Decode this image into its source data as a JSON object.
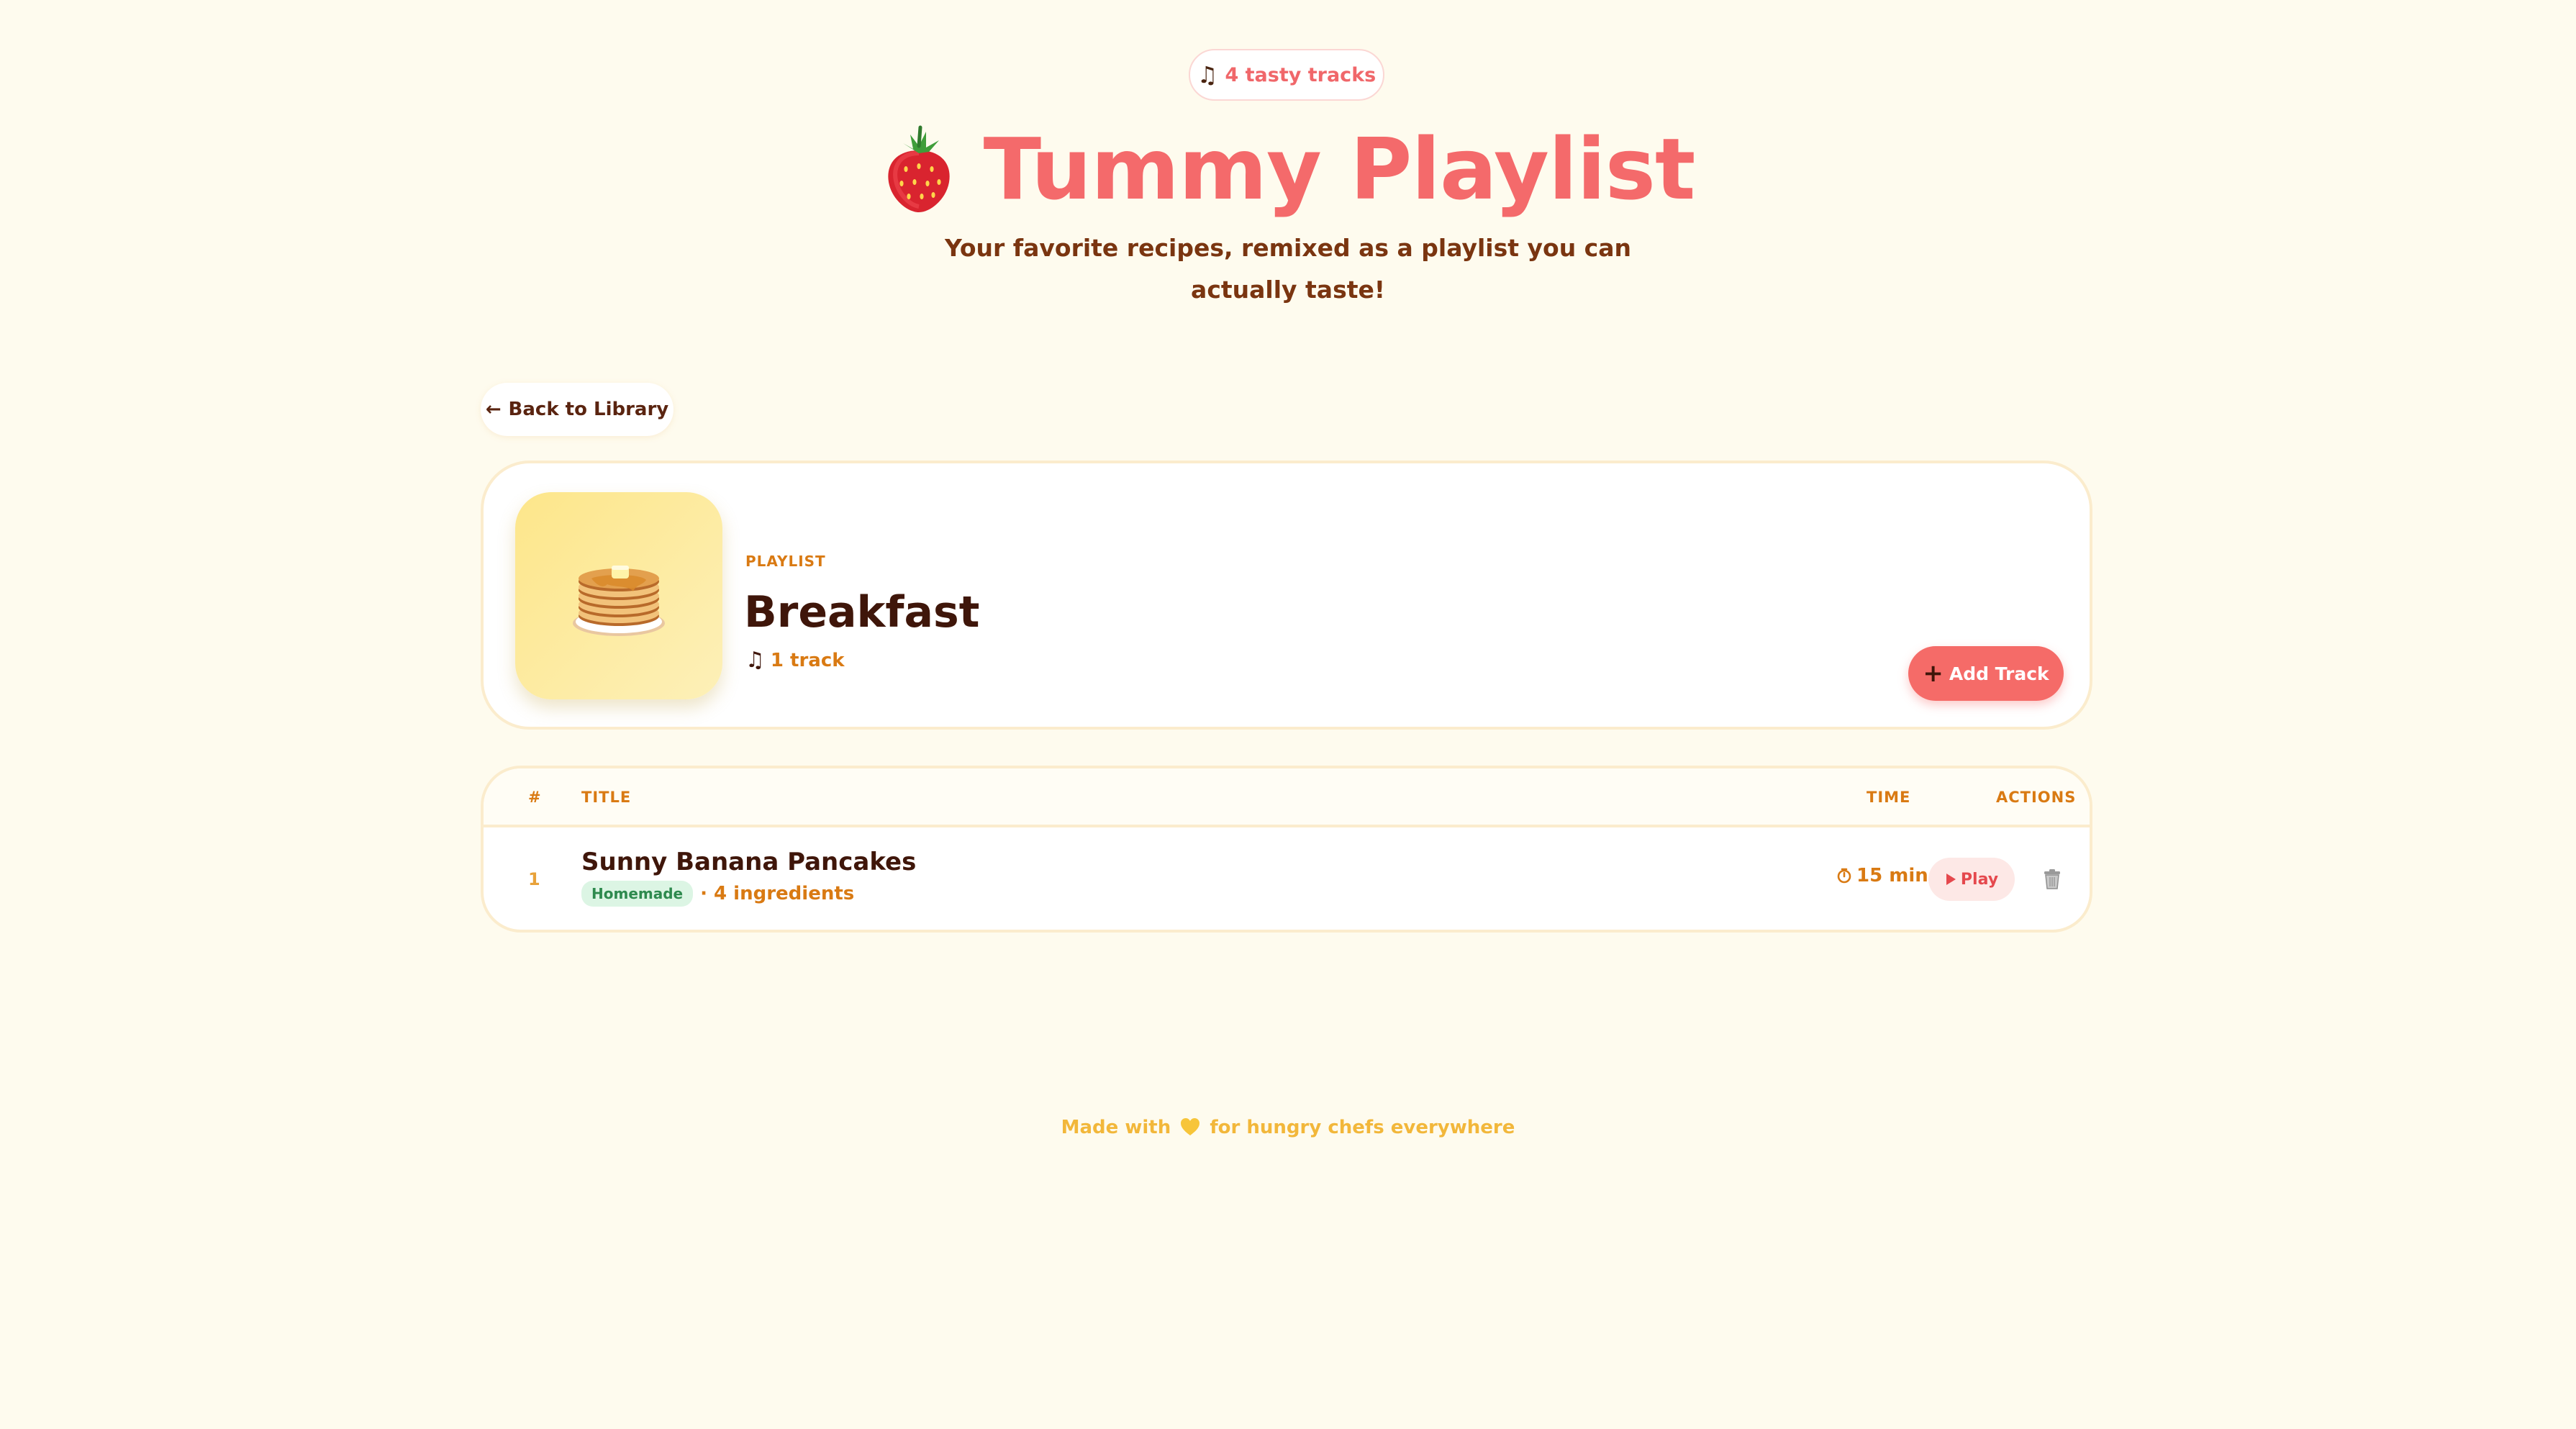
{
  "header": {
    "track_count": "4 tasty tracks",
    "title": "Tummy Playlist",
    "subtitle": "Your favorite recipes, remixed as a playlist you can actually taste!",
    "note_icon": "music-note-icon",
    "logo_icon": "strawberry-icon"
  },
  "nav": {
    "back_label": "Back to Library",
    "back_icon": "arrow-left-icon"
  },
  "playlist": {
    "kind_label": "PLAYLIST",
    "name": "Breakfast",
    "track_count": "1 track",
    "cover_icon": "pancakes-icon",
    "add_label": "Add Track",
    "add_icon": "plus-icon"
  },
  "table": {
    "columns": {
      "number": "#",
      "title": "TITLE",
      "time": "TIME",
      "actions": "ACTIONS"
    },
    "rows": [
      {
        "number": "1",
        "title": "Sunny Banana Pancakes",
        "tag": "Homemade",
        "ingredients": "· 4 ingredients",
        "time": "15 min",
        "play_label": "Play"
      }
    ]
  },
  "footer": {
    "text_before": "Made with",
    "text_after": "for hungry chefs everywhere",
    "heart_icon": "yellow-heart-icon"
  },
  "colors": {
    "background": "#fefbee",
    "accent": "#f46a6b",
    "brown": "#3f160a",
    "orange": "#d97a13",
    "border": "#fbeccd"
  }
}
